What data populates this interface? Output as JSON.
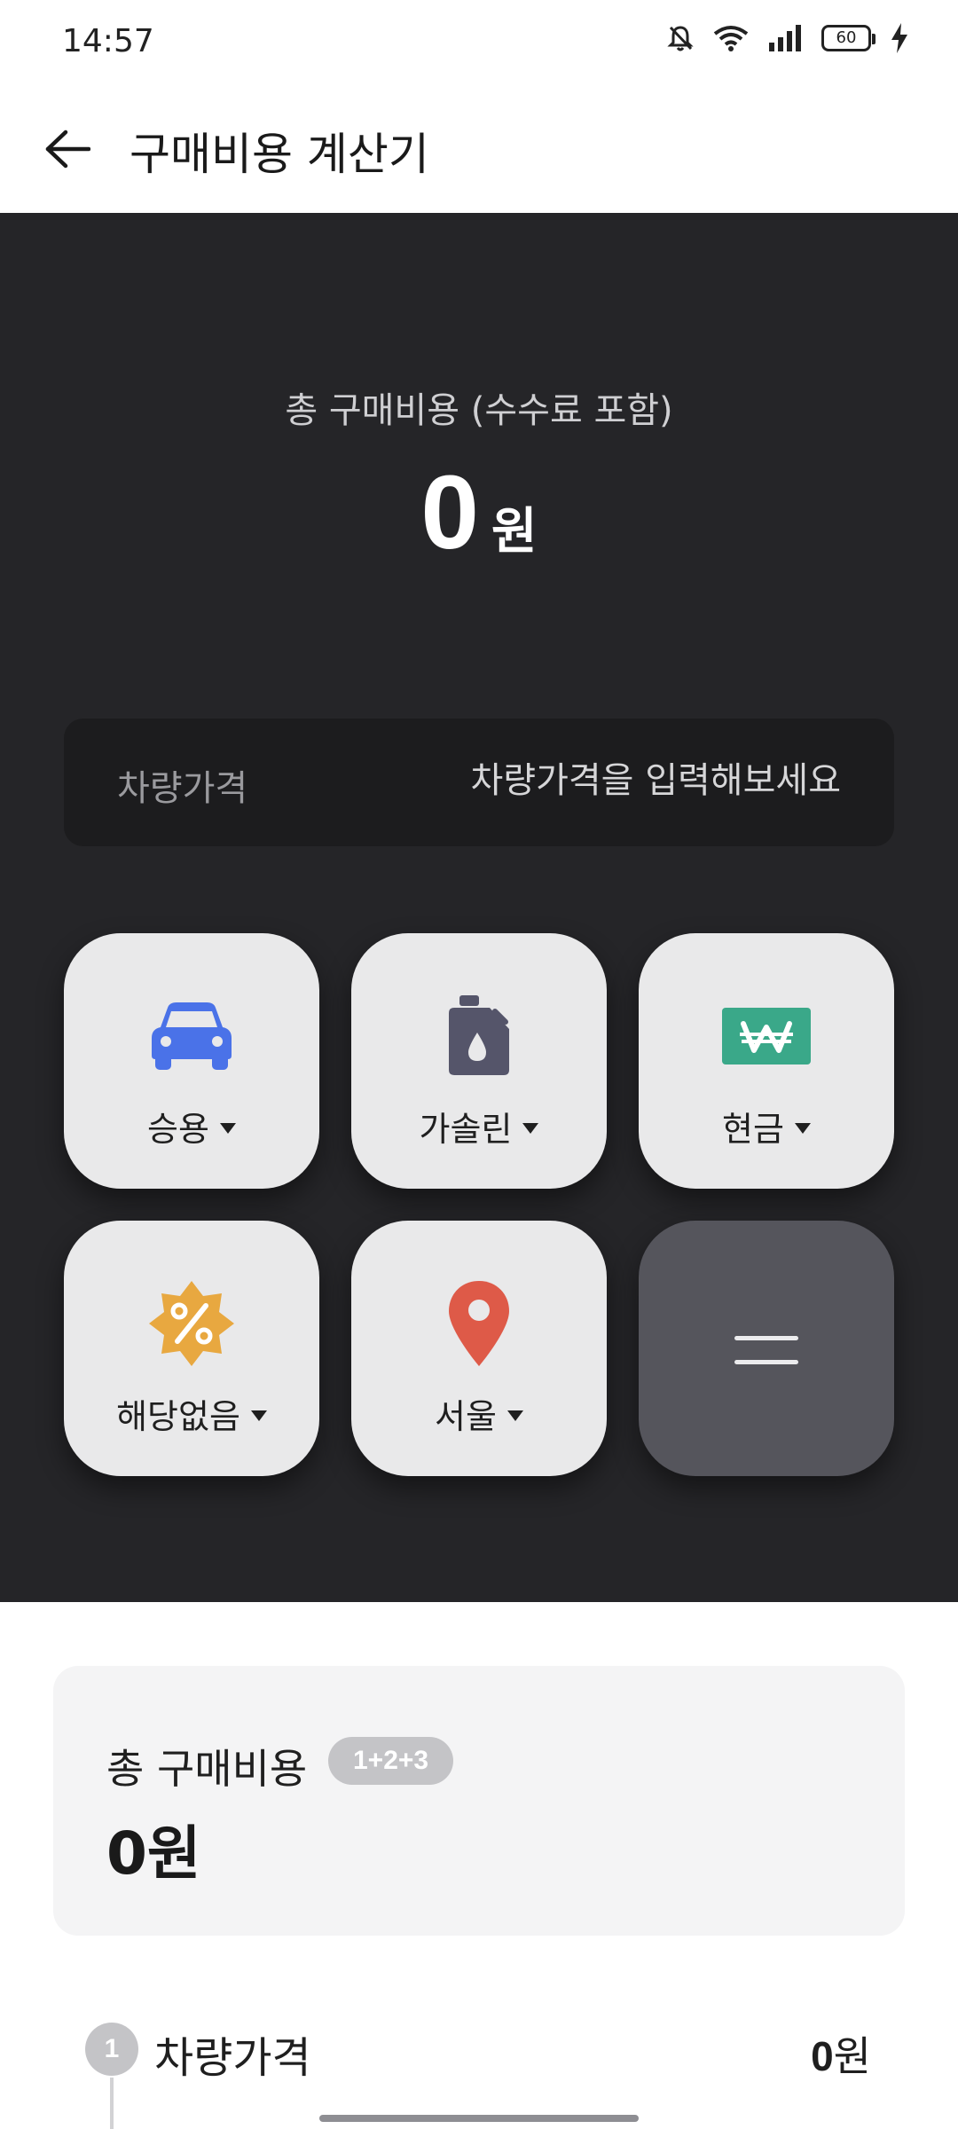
{
  "status_bar": {
    "time": "14:57",
    "battery": "60",
    "icons": [
      "mute-icon",
      "wifi-icon",
      "signal-icon",
      "battery-icon",
      "charging-icon"
    ]
  },
  "header": {
    "title": "구매비용 계산기",
    "back_icon": "back-arrow-icon"
  },
  "calculator": {
    "total_label": "총 구매비용 (수수료 포함)",
    "total_value": "0",
    "total_unit": "원",
    "price_label": "차량가격",
    "price_placeholder": "차량가격을 입력해보세요"
  },
  "options": {
    "vehicle_type": {
      "label": "승용",
      "icon": "car-icon",
      "color": "#4a72e8"
    },
    "fuel_type": {
      "label": "가솔린",
      "icon": "fuel-can-icon",
      "color": "#55556a"
    },
    "payment": {
      "label": "현금",
      "icon": "won-cash-icon",
      "color": "#3aa889"
    },
    "discount": {
      "label": "해당없음",
      "icon": "percent-badge-icon",
      "color": "#e8a840"
    },
    "region": {
      "label": "서울",
      "icon": "location-pin-icon",
      "color": "#de5a48"
    },
    "menu_icon": "equals-icon"
  },
  "summary": {
    "title": "총 구매비용",
    "badge": "1+2+3",
    "value": "0원"
  },
  "breakdown": [
    {
      "step": "1",
      "label": "차량가격",
      "value": "0",
      "unit": "원"
    }
  ]
}
